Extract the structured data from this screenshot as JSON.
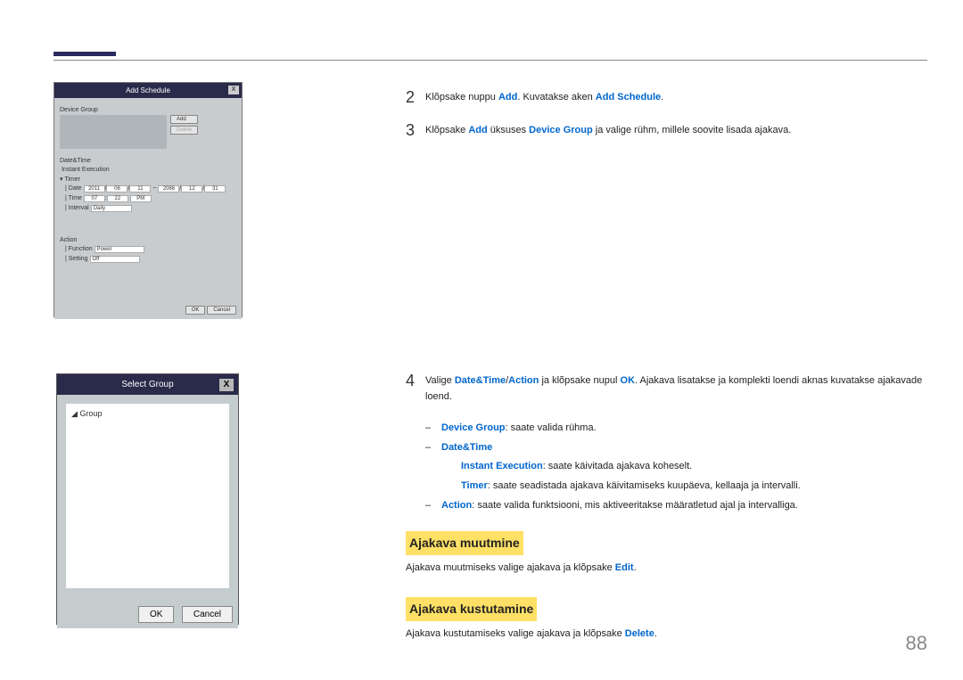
{
  "pageNumber": "88",
  "fig1": {
    "title": "Add Schedule",
    "closeX": "X",
    "deviceGroup": "Device Group",
    "addBtn": "Add",
    "deleteBtn": "Delete",
    "dateTime": "Date&Time",
    "instantExec": "Instant Execution",
    "timer": "Timer",
    "dateLabel": "Date",
    "dateY1": "2011",
    "dateM1": "06",
    "dateD1": "11",
    "dateY2": "2086",
    "dateM2": "12",
    "dateD2": "31",
    "timeLabel": "Time",
    "timeH": "07",
    "timeM": "22",
    "timeAP": "PM",
    "intervalLabel": "Interval",
    "intervalVal": "Daily",
    "action": "Action",
    "functionLabel": "Function",
    "functionVal": "Power",
    "settingLabel": "Setting",
    "settingVal": "Off",
    "okBtn": "OK",
    "cancelBtn": "Cancel"
  },
  "fig2": {
    "title": "Select Group",
    "closeX": "X",
    "groupItem": "Group",
    "okBtn": "OK",
    "cancelBtn": "Cancel"
  },
  "steps": {
    "s2": {
      "num": "2",
      "t1": "Klõpsake nuppu ",
      "t2": "Add",
      "t3": ". Kuvatakse aken ",
      "t4": "Add Schedule",
      "t5": "."
    },
    "s3": {
      "num": "3",
      "t1": "Klõpsake ",
      "t2": "Add",
      "t3": " üksuses ",
      "t4": "Device Group",
      "t5": " ja valige rühm, millele soovite lisada ajakava."
    },
    "s4": {
      "num": "4",
      "t1": "Valige ",
      "t2": "Date&Time",
      "t3": "/",
      "t4": "Action",
      "t5": " ja klõpsake nupul ",
      "t6": "OK",
      "t7": ". Ajakava lisatakse ja komplekti loendi aknas kuvatakse ajakavade loend."
    }
  },
  "sub": {
    "devGroup": {
      "label": "Device Group",
      "text": ": saate valida rühma."
    },
    "dateTime": {
      "label": "Date&Time"
    },
    "instant": {
      "label": "Instant Execution",
      "text": ": saate käivitada ajakava koheselt."
    },
    "timer": {
      "label": "Timer",
      "text": ": saate seadistada ajakava käivitamiseks kuupäeva, kellaaja ja intervalli."
    },
    "action": {
      "label": "Action",
      "text": ": saate valida funktsiooni, mis aktiveeritakse määratletud ajal ja intervalliga."
    }
  },
  "headings": {
    "h1": "Ajakava muutmine",
    "h1text1": "Ajakava muutmiseks valige ajakava ja klõpsake ",
    "h1text2": "Edit",
    "h1text3": ".",
    "h2": "Ajakava kustutamine",
    "h2text1": "Ajakava kustutamiseks valige ajakava ja klõpsake ",
    "h2text2": "Delete",
    "h2text3": "."
  },
  "sublistDash": "‒"
}
